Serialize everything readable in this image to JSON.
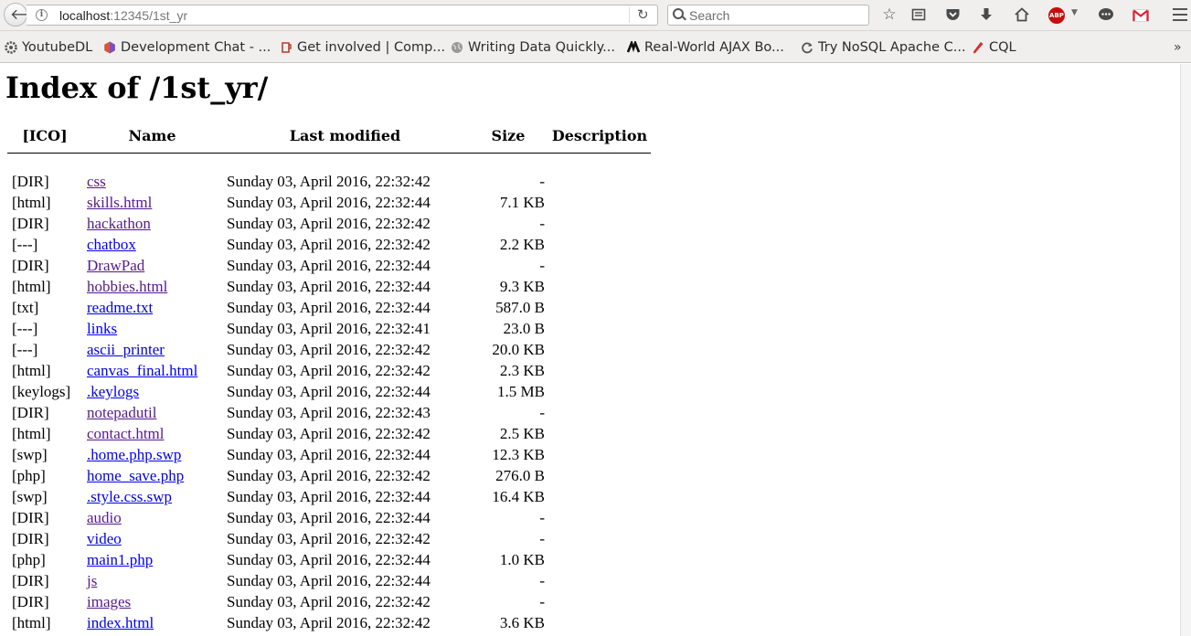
{
  "browser": {
    "url_host": "localhost",
    "url_path": ":12345/1st_yr",
    "search_placeholder": "Search",
    "abp_label": "ABP"
  },
  "bookmarks": [
    {
      "label": "YoutubeDL",
      "icon": "gear-favicon"
    },
    {
      "label": "Development Chat - ...",
      "icon": "hexagon-favicon"
    },
    {
      "label": "Get involved | Comp...",
      "icon": "mug-favicon"
    },
    {
      "label": "Writing Data Quickly...",
      "icon": "globe-favicon"
    },
    {
      "label": "Real-World AJAX Bo...",
      "icon": "logo-favicon"
    },
    {
      "label": "Try NoSQL Apache C...",
      "icon": "refresh-favicon"
    },
    {
      "label": "CQL",
      "icon": "pen-favicon"
    }
  ],
  "page": {
    "title": "Index of /1st_yr/",
    "columns": {
      "icon": "[ICO]",
      "name": "Name",
      "modified": "Last modified",
      "size": "Size",
      "description": "Description"
    },
    "rows": [
      {
        "icon": "[DIR]",
        "name": "css",
        "modified": "Sunday 03, April 2016, 22:32:42",
        "size": "-",
        "visited": true
      },
      {
        "icon": "[html]",
        "name": "skills.html",
        "modified": "Sunday 03, April 2016, 22:32:44",
        "size": "7.1 KB",
        "visited": true
      },
      {
        "icon": "[DIR]",
        "name": "hackathon",
        "modified": "Sunday 03, April 2016, 22:32:42",
        "size": "-",
        "visited": true
      },
      {
        "icon": "[---]",
        "name": "chatbox",
        "modified": "Sunday 03, April 2016, 22:32:42",
        "size": "2.2 KB",
        "visited": false
      },
      {
        "icon": "[DIR]",
        "name": "DrawPad",
        "modified": "Sunday 03, April 2016, 22:32:44",
        "size": "-",
        "visited": true
      },
      {
        "icon": "[html]",
        "name": "hobbies.html",
        "modified": "Sunday 03, April 2016, 22:32:44",
        "size": "9.3 KB",
        "visited": true
      },
      {
        "icon": "[txt]",
        "name": "readme.txt",
        "modified": "Sunday 03, April 2016, 22:32:44",
        "size": "587.0 B",
        "visited": false
      },
      {
        "icon": "[---]",
        "name": "links",
        "modified": "Sunday 03, April 2016, 22:32:41",
        "size": "23.0 B",
        "visited": false
      },
      {
        "icon": "[---]",
        "name": "ascii_printer",
        "modified": "Sunday 03, April 2016, 22:32:42",
        "size": "20.0 KB",
        "visited": false
      },
      {
        "icon": "[html]",
        "name": "canvas_final.html",
        "modified": "Sunday 03, April 2016, 22:32:42",
        "size": "2.3 KB",
        "visited": false
      },
      {
        "icon": "[keylogs]",
        "name": ".keylogs",
        "modified": "Sunday 03, April 2016, 22:32:44",
        "size": "1.5 MB",
        "visited": false
      },
      {
        "icon": "[DIR]",
        "name": "notepadutil",
        "modified": "Sunday 03, April 2016, 22:32:43",
        "size": "-",
        "visited": true
      },
      {
        "icon": "[html]",
        "name": "contact.html",
        "modified": "Sunday 03, April 2016, 22:32:42",
        "size": "2.5 KB",
        "visited": true
      },
      {
        "icon": "[swp]",
        "name": ".home.php.swp",
        "modified": "Sunday 03, April 2016, 22:32:44",
        "size": "12.3 KB",
        "visited": false
      },
      {
        "icon": "[php]",
        "name": "home_save.php",
        "modified": "Sunday 03, April 2016, 22:32:42",
        "size": "276.0 B",
        "visited": false
      },
      {
        "icon": "[swp]",
        "name": ".style.css.swp",
        "modified": "Sunday 03, April 2016, 22:32:44",
        "size": "16.4 KB",
        "visited": false
      },
      {
        "icon": "[DIR]",
        "name": "audio",
        "modified": "Sunday 03, April 2016, 22:32:44",
        "size": "-",
        "visited": true
      },
      {
        "icon": "[DIR]",
        "name": "video",
        "modified": "Sunday 03, April 2016, 22:32:42",
        "size": "-",
        "visited": false
      },
      {
        "icon": "[php]",
        "name": "main1.php",
        "modified": "Sunday 03, April 2016, 22:32:44",
        "size": "1.0 KB",
        "visited": false
      },
      {
        "icon": "[DIR]",
        "name": "js",
        "modified": "Sunday 03, April 2016, 22:32:44",
        "size": "-",
        "visited": true
      },
      {
        "icon": "[DIR]",
        "name": "images",
        "modified": "Sunday 03, April 2016, 22:32:42",
        "size": "-",
        "visited": true
      },
      {
        "icon": "[html]",
        "name": "index.html",
        "modified": "Sunday 03, April 2016, 22:32:42",
        "size": "3.6 KB",
        "visited": false
      }
    ]
  }
}
